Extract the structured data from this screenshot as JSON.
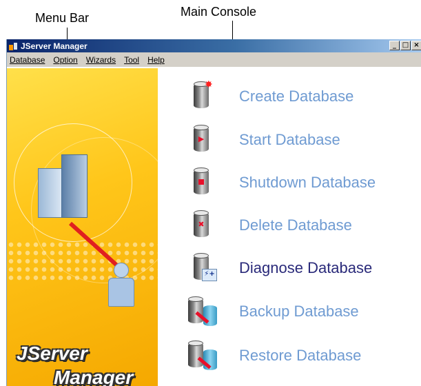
{
  "annotations": {
    "menu_bar": "Menu Bar",
    "main_console": "Main Console"
  },
  "window": {
    "title": "JServer Manager",
    "controls": {
      "minimize": "_",
      "maximize": "□",
      "close": "×"
    }
  },
  "menu": {
    "items": [
      "Database",
      "Option",
      "Wizards",
      "Tool",
      "Help"
    ]
  },
  "brand": {
    "line1": "JServer",
    "line2": "Manager"
  },
  "console": {
    "items": [
      {
        "label": "Create Database",
        "icon": "create-database-icon"
      },
      {
        "label": "Start Database",
        "icon": "start-database-icon"
      },
      {
        "label": "Shutdown Database",
        "icon": "shutdown-database-icon"
      },
      {
        "label": "Delete Database",
        "icon": "delete-database-icon"
      },
      {
        "label": "Diagnose Database",
        "icon": "diagnose-database-icon"
      },
      {
        "label": "Backup Database",
        "icon": "backup-database-icon"
      },
      {
        "label": "Restore Database",
        "icon": "restore-database-icon"
      }
    ],
    "colors": {
      "link": "#6f9bd2",
      "active": "#2a2a7a",
      "title_bar": "#0a246a",
      "panel": "#ffc61a"
    }
  }
}
